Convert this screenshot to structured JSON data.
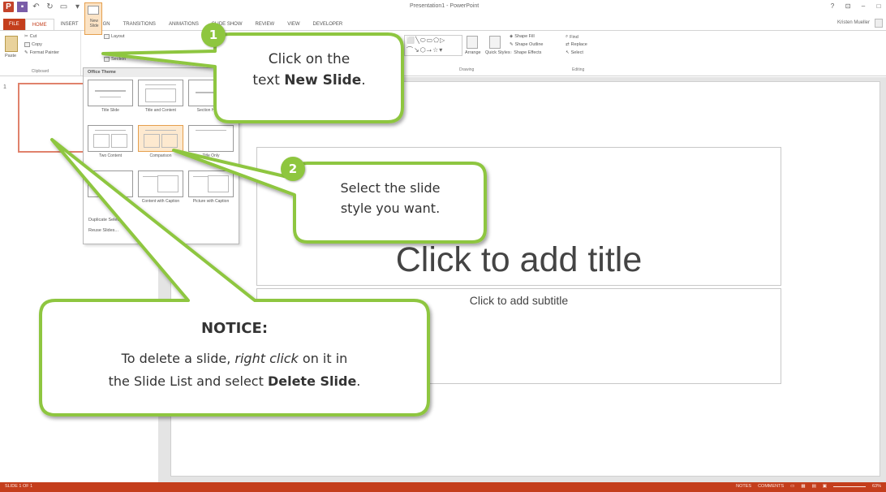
{
  "window": {
    "title": "Presentation1 - PowerPoint",
    "user": "Kristen Mueller",
    "controls": [
      "?",
      "⊡",
      "–",
      "□"
    ]
  },
  "tabs": [
    "FILE",
    "HOME",
    "INSERT",
    "DESIGN",
    "TRANSITIONS",
    "ANIMATIONS",
    "SLIDE SHOW",
    "REVIEW",
    "VIEW",
    "DEVELOPER"
  ],
  "active_tab": "HOME",
  "ribbon": {
    "clipboard": {
      "paste": "Paste",
      "cut": "Cut",
      "copy": "Copy",
      "format_painter": "Format Painter",
      "label": "Clipboard"
    },
    "slides": {
      "new_slide": "New Slide",
      "layout": "Layout",
      "section": "Section"
    },
    "drawing": {
      "arrange": "Arrange",
      "quick_styles": "Quick Styles",
      "shape_fill": "Shape Fill",
      "shape_outline": "Shape Outline",
      "shape_effects": "Shape Effects",
      "label": "Drawing"
    },
    "editing": {
      "find": "Find",
      "replace": "Replace",
      "select": "Select",
      "label": "Editing"
    }
  },
  "gallery": {
    "header": "Office Theme",
    "layouts": [
      "Title Slide",
      "Title and Content",
      "Section Header",
      "Two Content",
      "Comparison",
      "Title Only",
      "Blank",
      "Content with Caption",
      "Picture with Caption"
    ],
    "hovered_layout": "Comparison",
    "link_duplicate": "Duplicate Selected Slides",
    "link_reuse": "Reuse Slides..."
  },
  "slide_list": {
    "number": "1"
  },
  "slide": {
    "title_placeholder": "Click to add title",
    "subtitle_placeholder": "Click to add subtitle"
  },
  "statusbar": {
    "slide_info": "SLIDE 1 OF 1",
    "notes": "NOTES",
    "comments": "COMMENTS",
    "zoom": "63%"
  },
  "callouts": {
    "step1": {
      "number": "1",
      "line1": "Click on the",
      "line2_prefix": "text ",
      "line2_bold": "New Slide",
      "line2_suffix": "."
    },
    "step2": {
      "number": "2",
      "line1": "Select the slide",
      "line2": "style you want."
    },
    "notice": {
      "heading": "NOTICE:",
      "line1_prefix": "To delete a slide, ",
      "line1_italic": "right click",
      "line1_suffix": " on it in",
      "line2_prefix": "the Slide List and select ",
      "line2_bold": "Delete Slide",
      "line2_suffix": "."
    },
    "color": "#8ec63f"
  }
}
